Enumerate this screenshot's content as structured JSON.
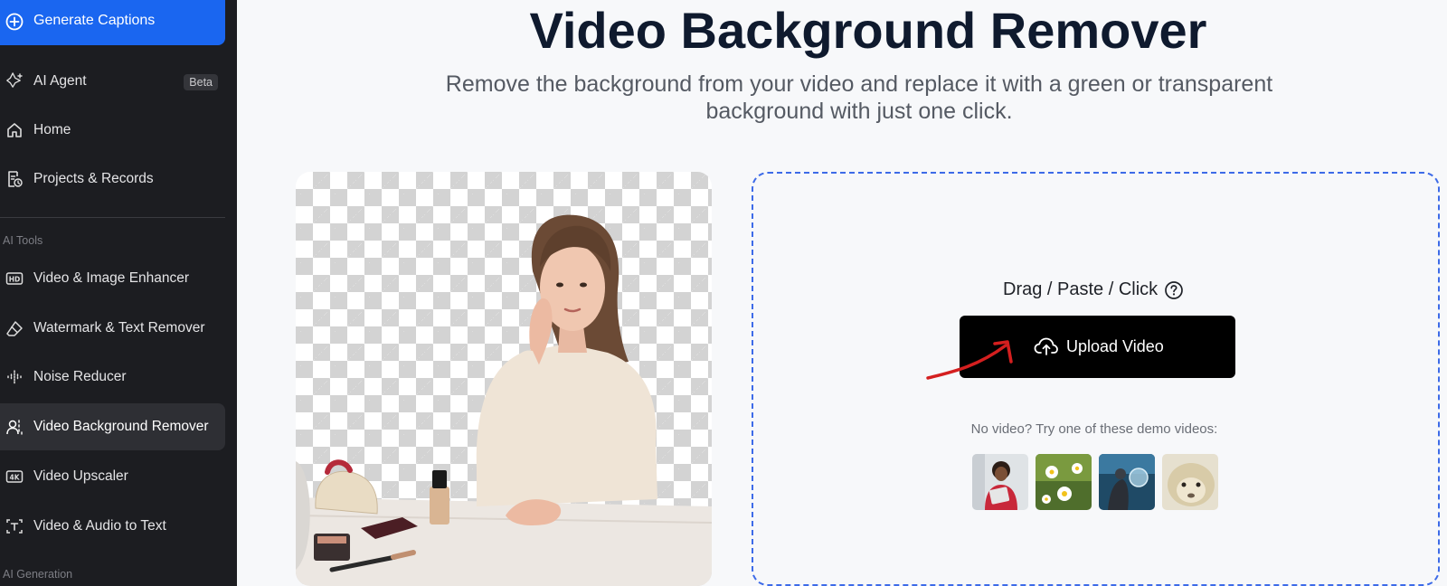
{
  "sidebar": {
    "generate_label": "Generate Captions",
    "items": [
      {
        "label": "AI Agent",
        "badge": "Beta"
      },
      {
        "label": "Home"
      },
      {
        "label": "Projects & Records"
      },
      {
        "label": "Video & Image Enhancer"
      },
      {
        "label": "Watermark & Text Remover"
      },
      {
        "label": "Noise Reducer"
      },
      {
        "label": "Video Background Remover"
      },
      {
        "label": "Video Upscaler"
      },
      {
        "label": "Video & Audio to Text"
      }
    ],
    "section_ai_tools": "AI Tools",
    "section_ai_generation": "AI Generation",
    "colors": {
      "bg": "#1c1d21",
      "accent": "#1a66f0",
      "active": "#2e2f34"
    }
  },
  "main": {
    "title": "Video Background Remover",
    "subtitle": "Remove the background from your video and replace it with a green or transparent background with just one click.",
    "drop_hint": "Drag / Paste / Click",
    "upload_label": "Upload Video",
    "demo_hint": "No video? Try one of these demo videos:",
    "demo_thumbnails": [
      "woman-with-tablet",
      "daisies",
      "diver-with-bubble",
      "alpaca"
    ]
  },
  "icons": {
    "generate": "plus-circle-icon",
    "ai_agent": "sparkle-icon",
    "home": "home-icon",
    "projects": "document-clock-icon",
    "enhancer": "hd-icon",
    "watermark": "eraser-icon",
    "noise": "waveform-icon",
    "bg_remover": "person-cutout-icon",
    "upscaler": "4k-icon",
    "to_text": "text-frame-icon",
    "help": "question-circle-icon",
    "upload": "cloud-upload-icon"
  }
}
